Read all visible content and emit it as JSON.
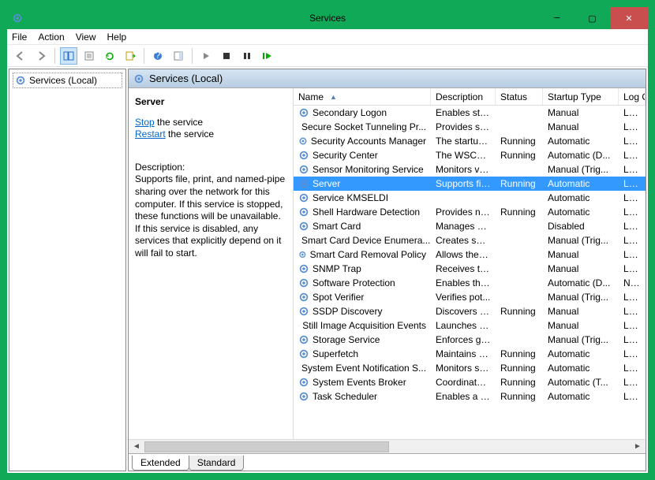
{
  "window": {
    "title": "Services"
  },
  "menu": {
    "file": "File",
    "action": "Action",
    "view": "View",
    "help": "Help"
  },
  "left": {
    "root": "Services (Local)"
  },
  "panel": {
    "header": "Services (Local)",
    "sel_name": "Server",
    "stop_lnk": "Stop",
    "stop_suffix": " the service",
    "restart_lnk": "Restart",
    "restart_suffix": " the service",
    "desc_label": "Description:",
    "desc": "Supports file, print, and named-pipe sharing over the network for this computer. If this service is stopped, these functions will be unavailable. If this service is disabled, any services that explicitly depend on it will fail to start."
  },
  "cols": {
    "name": "Name",
    "desc": "Description",
    "stat": "Status",
    "start": "Startup Type",
    "log": "Log On As"
  },
  "rows": [
    {
      "n": "Secondary Logon",
      "d": "Enables star...",
      "s": "",
      "t": "Manual",
      "l": "Loca"
    },
    {
      "n": "Secure Socket Tunneling Pr...",
      "d": "Provides su...",
      "s": "",
      "t": "Manual",
      "l": "Loca"
    },
    {
      "n": "Security Accounts Manager",
      "d": "The startup ...",
      "s": "Running",
      "t": "Automatic",
      "l": "Loca"
    },
    {
      "n": "Security Center",
      "d": "The WSCSV...",
      "s": "Running",
      "t": "Automatic (D...",
      "l": "Loca"
    },
    {
      "n": "Sensor Monitoring Service",
      "d": "Monitors va...",
      "s": "",
      "t": "Manual (Trig...",
      "l": "Loca"
    },
    {
      "n": "Server",
      "d": "Supports fil...",
      "s": "Running",
      "t": "Automatic",
      "l": "Loca",
      "sel": true
    },
    {
      "n": "Service KMSELDI",
      "d": "",
      "s": "",
      "t": "Automatic",
      "l": "Loca"
    },
    {
      "n": "Shell Hardware Detection",
      "d": "Provides no...",
      "s": "Running",
      "t": "Automatic",
      "l": "Loca"
    },
    {
      "n": "Smart Card",
      "d": "Manages ac...",
      "s": "",
      "t": "Disabled",
      "l": "Loca"
    },
    {
      "n": "Smart Card Device Enumera...",
      "d": "Creates soft...",
      "s": "",
      "t": "Manual (Trig...",
      "l": "Loca"
    },
    {
      "n": "Smart Card Removal Policy",
      "d": "Allows the s...",
      "s": "",
      "t": "Manual",
      "l": "Loca"
    },
    {
      "n": "SNMP Trap",
      "d": "Receives tra...",
      "s": "",
      "t": "Manual",
      "l": "Loca"
    },
    {
      "n": "Software Protection",
      "d": "Enables the ...",
      "s": "",
      "t": "Automatic (D...",
      "l": "Netw"
    },
    {
      "n": "Spot Verifier",
      "d": "Verifies pot...",
      "s": "",
      "t": "Manual (Trig...",
      "l": "Loca"
    },
    {
      "n": "SSDP Discovery",
      "d": "Discovers n...",
      "s": "Running",
      "t": "Manual",
      "l": "Loca"
    },
    {
      "n": "Still Image Acquisition Events",
      "d": "Launches a...",
      "s": "",
      "t": "Manual",
      "l": "Loca"
    },
    {
      "n": "Storage Service",
      "d": "Enforces gr...",
      "s": "",
      "t": "Manual (Trig...",
      "l": "Loca"
    },
    {
      "n": "Superfetch",
      "d": "Maintains a...",
      "s": "Running",
      "t": "Automatic",
      "l": "Loca"
    },
    {
      "n": "System Event Notification S...",
      "d": "Monitors sy...",
      "s": "Running",
      "t": "Automatic",
      "l": "Loca"
    },
    {
      "n": "System Events Broker",
      "d": "Coordinates...",
      "s": "Running",
      "t": "Automatic (T...",
      "l": "Loca"
    },
    {
      "n": "Task Scheduler",
      "d": "Enables a us...",
      "s": "Running",
      "t": "Automatic",
      "l": "Loca"
    }
  ],
  "tabs": {
    "ext": "Extended",
    "std": "Standard"
  }
}
